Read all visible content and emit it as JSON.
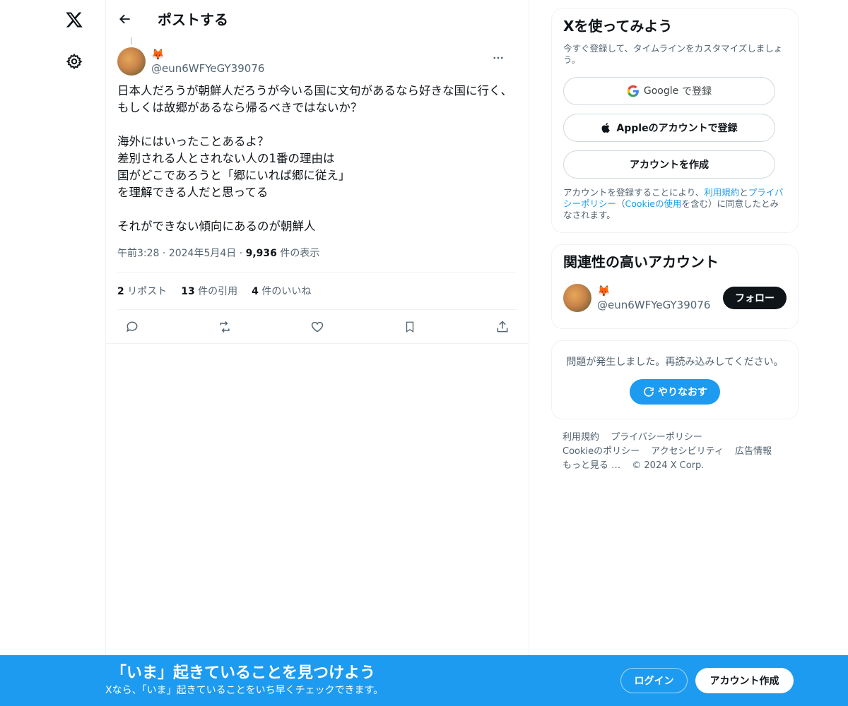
{
  "nav": {
    "logo_icon": "x-logo-icon",
    "settings_icon": "gear-icon"
  },
  "header": {
    "title": "ポストする"
  },
  "tweet": {
    "author_name": "🦊",
    "author_handle": "@eun6WFYeGY39076",
    "text": "日本人だろうが朝鮮人だろうが今いる国に文句があるなら好きな国に行く、もしくは故郷があるなら帰るべきではないか？\n\n海外にはいったことあるよ？\n差別される人とされない人の1番の理由は\n国がどこであろうと「郷にいれば郷に従え」\nを理解できる人だと思ってる\n\nそれができない傾向にあるのが朝鮮人",
    "time": "午前3:28",
    "date": "2024年5月4日",
    "views_count": "9,936",
    "views_label": "件の表示",
    "reposts_count": "2",
    "reposts_label": "リポスト",
    "quotes_count": "13",
    "quotes_label": "件の引用",
    "likes_count": "4",
    "likes_label": "件のいいね"
  },
  "signup_card": {
    "title": "Xを使ってみよう",
    "subtitle": "今すぐ登録して、タイムラインをカスタマイズしましょう。",
    "google_label": "Google",
    "google_suffix": "で登録",
    "apple_label": "Appleのアカウントで登録",
    "create_label": "アカウントを作成",
    "legal_prefix": "アカウントを登録することにより、",
    "legal_terms": "利用規約",
    "legal_and": "と",
    "legal_privacy": "プライバシーポリシー",
    "legal_paren_open": "（",
    "legal_cookie": "Cookieの使用",
    "legal_suffix": "を含む）に同意したとみなされます。"
  },
  "related": {
    "title": "関連性の高いアカウント",
    "name": "🦊",
    "handle": "@eun6WFYeGY39076",
    "follow_label": "フォロー"
  },
  "error": {
    "message": "問題が発生しました。再読み込みしてください。",
    "retry_label": "やりなおす"
  },
  "footer": {
    "terms": "利用規約",
    "privacy": "プライバシーポリシー",
    "cookie": "Cookieのポリシー",
    "accessibility": "アクセシビリティ",
    "ads": "広告情報",
    "more": "もっと見る …",
    "copyright": "© 2024 X Corp."
  },
  "bottom_bar": {
    "title": "「いま」起きていることを見つけよう",
    "subtitle": "Xなら、「いま」起きていることをいち早くチェックできます。",
    "login_label": "ログイン",
    "signup_label": "アカウント作成"
  },
  "colors": {
    "accent": "#1d9bf0",
    "text": "#0f1419",
    "secondary": "#536471",
    "border": "#eff3f4"
  }
}
